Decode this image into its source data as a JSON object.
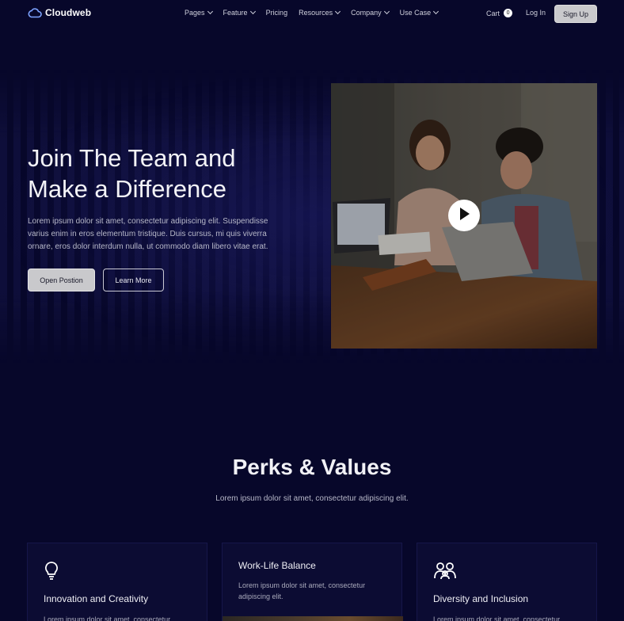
{
  "brand": {
    "name": "Cloudweb",
    "accent": "#7da3ff"
  },
  "nav": {
    "items": [
      {
        "label": "Pages",
        "dropdown": true
      },
      {
        "label": "Feature",
        "dropdown": true
      },
      {
        "label": "Pricing",
        "dropdown": false
      },
      {
        "label": "Resources",
        "dropdown": true
      },
      {
        "label": "Company",
        "dropdown": true
      },
      {
        "label": "Use Case",
        "dropdown": true
      }
    ],
    "cart_label": "Cart",
    "cart_count": "0",
    "login_label": "Log In",
    "signup_label": "Sign Up"
  },
  "hero": {
    "title": "Join The Team and Make a Difference",
    "text": "Lorem ipsum dolor sit amet, consectetur adipiscing elit. Suspendisse varius enim in eros elementum tristique. Duis cursus, mi quis viverra ornare, eros dolor interdum nulla, ut commodo diam libero vitae erat.",
    "primary_button": "Open Postion",
    "secondary_button": "Learn More",
    "image_icon": "play-icon"
  },
  "perks": {
    "title": "Perks & Values",
    "subtitle": "Lorem ipsum dolor sit amet, consectetur adipiscing elit.",
    "cards": [
      {
        "icon": "lightbulb-icon",
        "title": "Innovation and Creativity",
        "text": "Lorem ipsum dolor sit amet, consectetur"
      },
      {
        "icon": "",
        "title": "Work-Life Balance",
        "text": "Lorem ipsum dolor sit amet, consectetur adipiscing elit."
      },
      {
        "icon": "people-icon",
        "title": "Diversity and Inclusion",
        "text": "Lorem ipsum dolor sit amet, consectetur"
      }
    ]
  },
  "colors": {
    "background": "#07072a",
    "card": "#0c0c33",
    "button_light": "#c9c9cc"
  }
}
